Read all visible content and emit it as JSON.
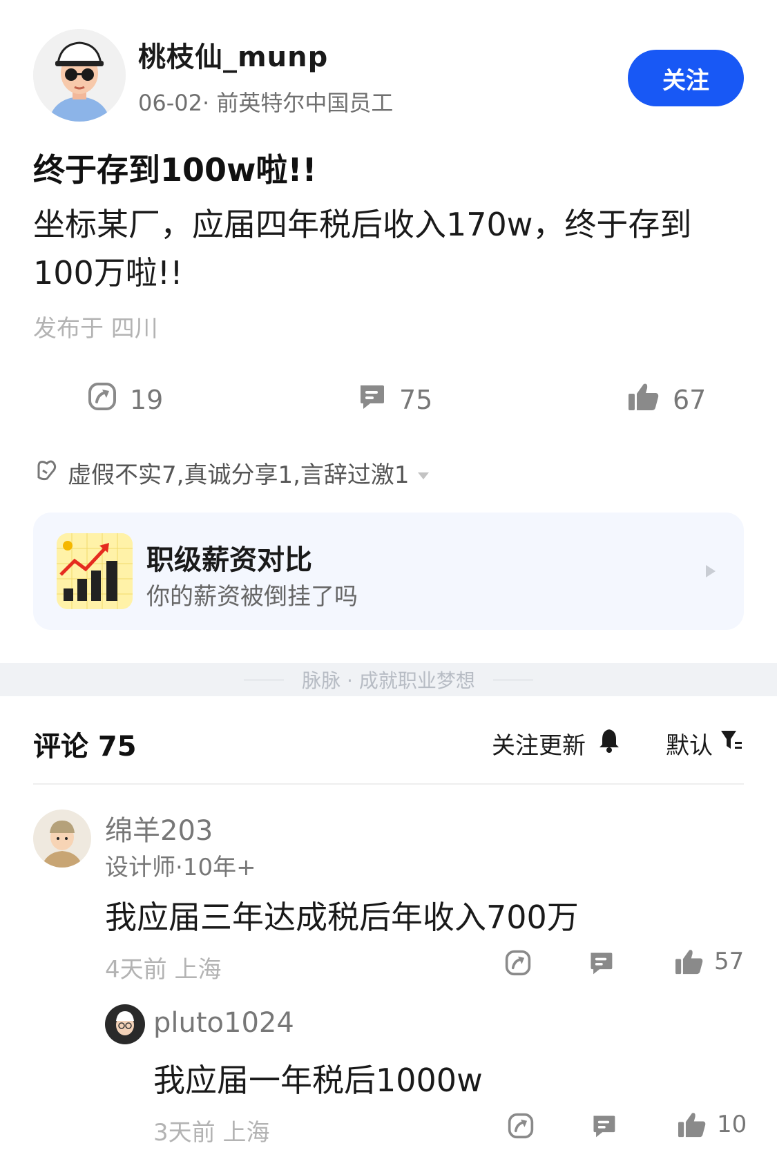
{
  "post": {
    "author": "桃枝仙_munp",
    "meta": "06-02· 前英特尔中国员工",
    "follow_label": "关注",
    "title": "终于存到100w啦!!",
    "body": "坐标某厂，应届四年税后收入170w，终于存到100万啦!!",
    "location": "发布于 四川",
    "actions": {
      "share_count": "19",
      "comment_count": "75",
      "like_count": "67"
    },
    "reactions": "虚假不实7,真诚分享1,言辞过激1"
  },
  "promo_card": {
    "title": "职级薪资对比",
    "subtitle": "你的薪资被倒挂了吗"
  },
  "divider_text": "脉脉 · 成就职业梦想",
  "comments_section": {
    "header": "评论 75",
    "follow_update_label": "关注更新",
    "sort_label": "默认"
  },
  "comments": [
    {
      "name": "绵羊203",
      "meta": "设计师·10年+",
      "text": "我应届三年达成税后年收入700万",
      "time": "4天前  上海",
      "likes": "57"
    }
  ],
  "replies": [
    {
      "name": "pluto1024",
      "text": "我应届一年税后1000w",
      "time": "3天前  上海",
      "likes": "10"
    }
  ],
  "colors": {
    "accent": "#1858f5",
    "icon_gray": "#8a8a8a",
    "card_bg": "#f4f7fe"
  },
  "icons": {
    "share": "share-icon",
    "comment": "comment-icon",
    "like": "thumbs-up-icon",
    "bell": "bell-icon",
    "filter": "filter-icon"
  }
}
